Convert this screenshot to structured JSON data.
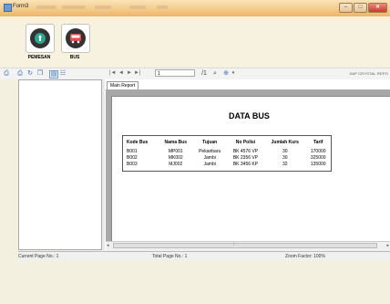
{
  "window": {
    "title": "Form3",
    "close_glyph": "✕",
    "min_glyph": "–",
    "max_glyph": "□"
  },
  "toolbar": {
    "buttons": [
      {
        "label": "PEMESAN",
        "icon": "booking-icon"
      },
      {
        "label": "BUS",
        "icon": "bus-icon"
      }
    ]
  },
  "viewer": {
    "page_box_value": "1",
    "brand": "SAP CRYSTAL REPO",
    "tab_label": "Main Report",
    "nav": [
      "|◄",
      "◄",
      "►",
      "►|"
    ]
  },
  "report": {
    "title": "DATA BUS",
    "columns": [
      "Kode Bus",
      "Nama Bus",
      "Tujuan",
      "No Polisi",
      "Jumlah Kurs",
      "Tarif"
    ],
    "rows": [
      [
        "B001",
        "MP001",
        "Pekanbaru",
        "BK 4576 VP",
        "30",
        "170000"
      ],
      [
        "B002",
        "MK002",
        "Jambi",
        "BK 2356 VP",
        "30",
        "325000"
      ],
      [
        "B003",
        "MJ002",
        "Jambi",
        "BK 3456 KP",
        "32",
        "135000"
      ]
    ]
  },
  "status": {
    "current_page": "Current Page No.: 1",
    "total_page": "Total Page No.: 1",
    "zoom": "Zoom Factor: 100%"
  }
}
